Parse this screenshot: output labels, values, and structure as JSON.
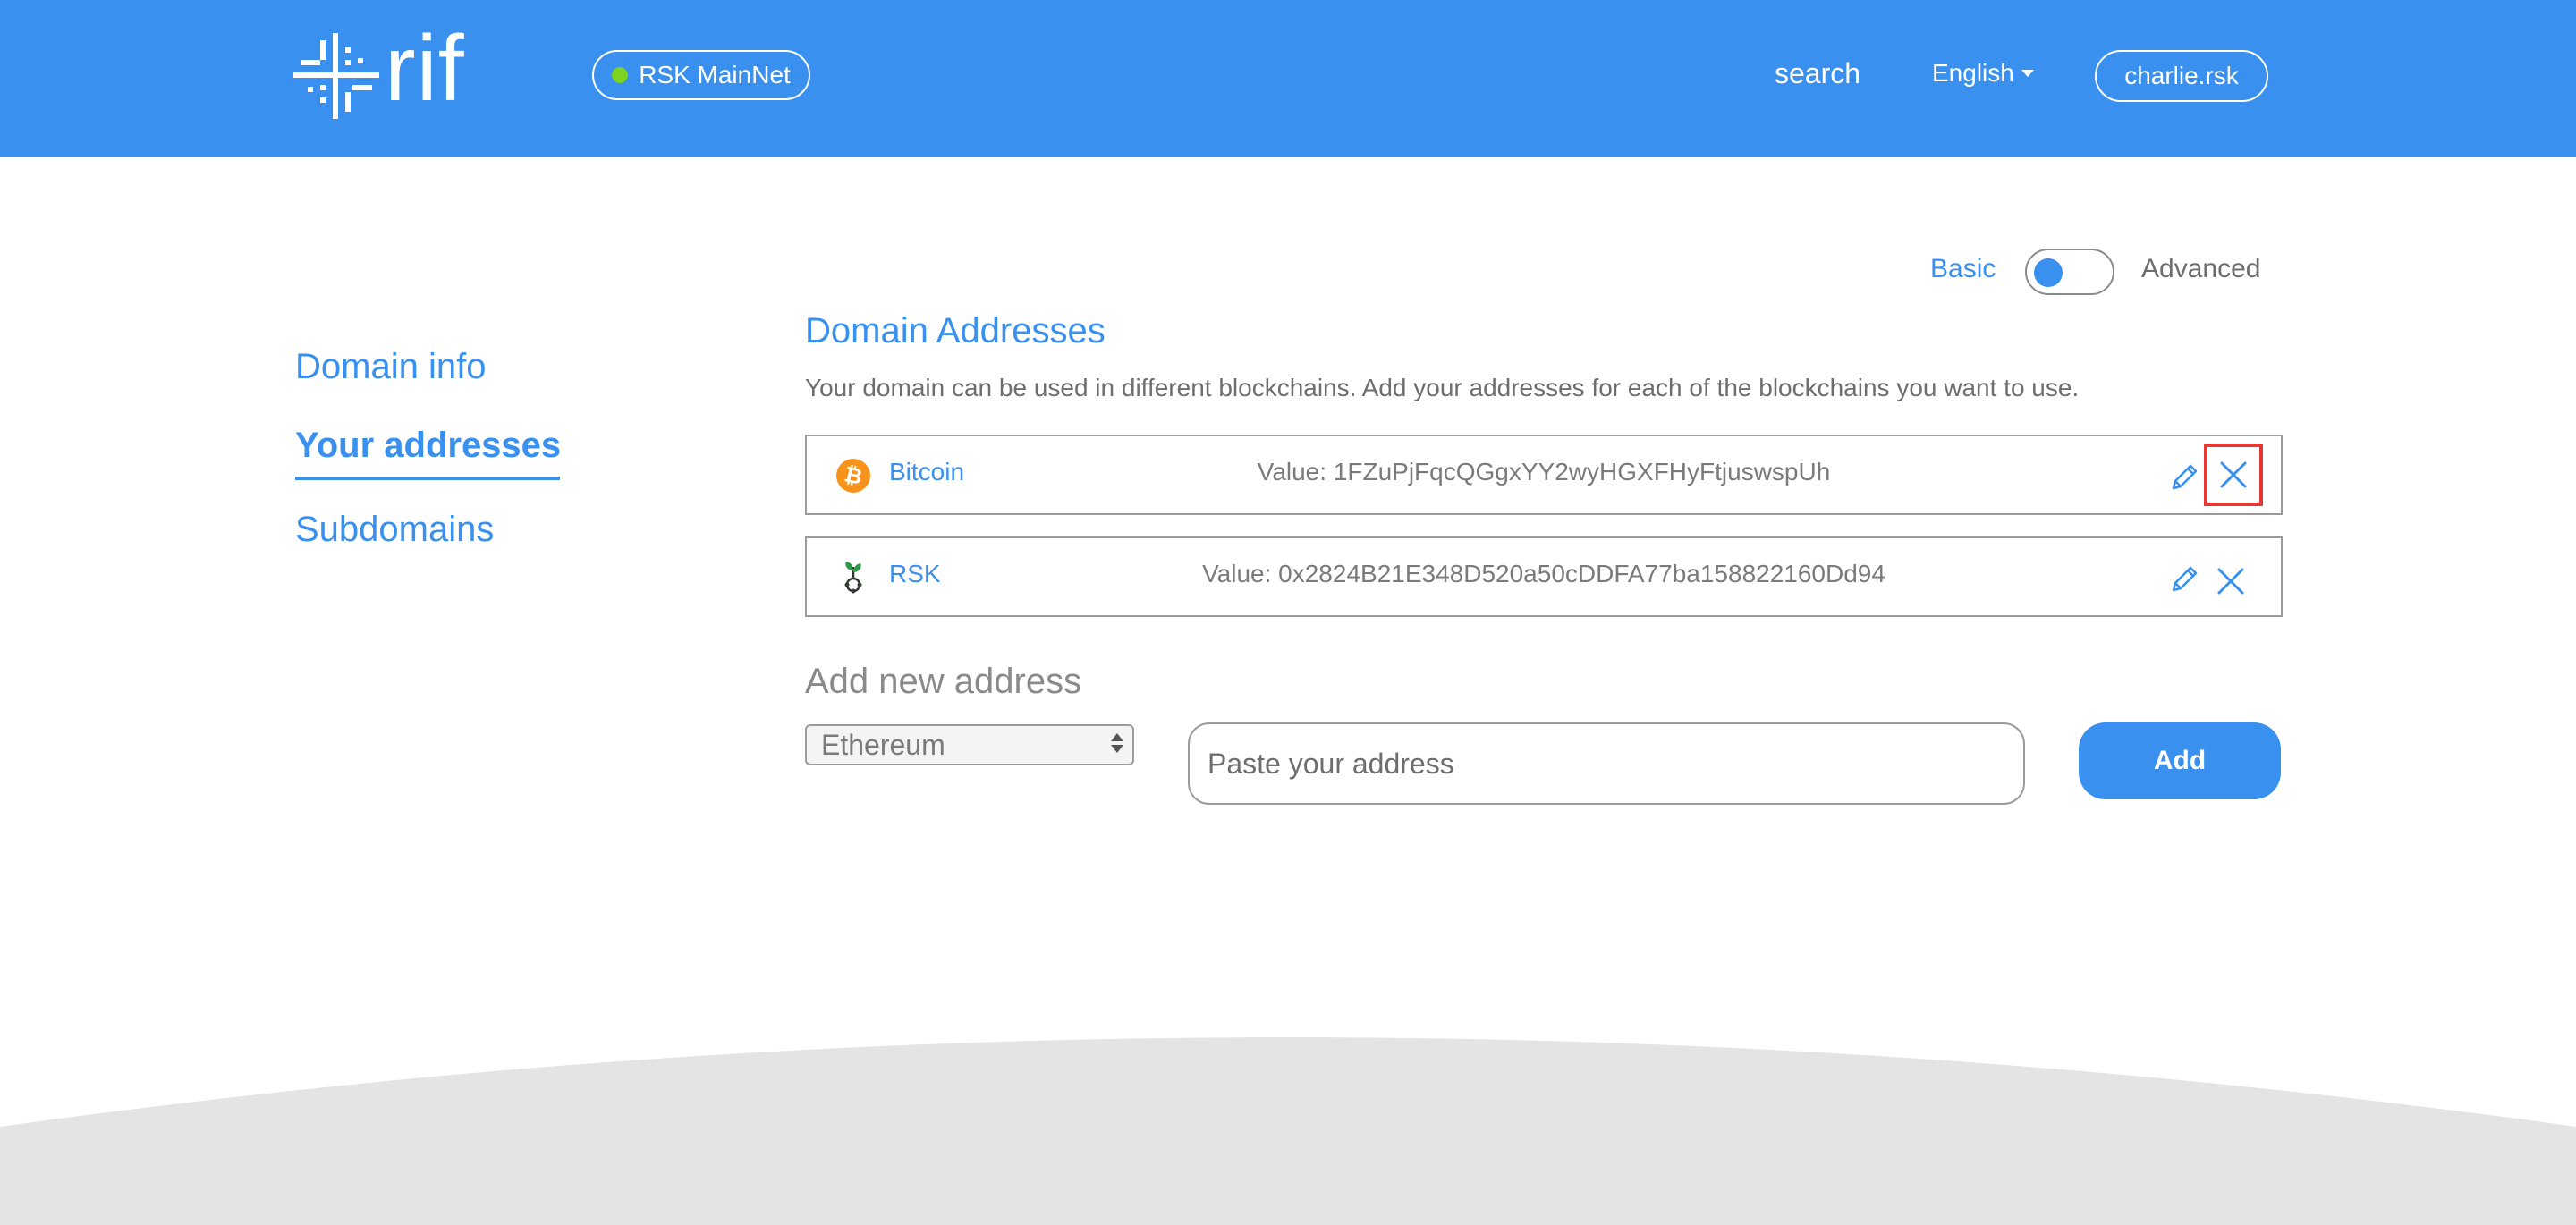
{
  "header": {
    "logo_text": "rif",
    "network_label": "RSK MainNet",
    "search_label": "search",
    "language": "English",
    "account": "charlie.rsk"
  },
  "mode_toggle": {
    "basic_label": "Basic",
    "advanced_label": "Advanced",
    "selected": "Basic"
  },
  "sidebar": {
    "items": [
      {
        "label": "Domain info",
        "active": false
      },
      {
        "label": "Your addresses",
        "active": true
      },
      {
        "label": "Subdomains",
        "active": false
      }
    ]
  },
  "main": {
    "title": "Domain Addresses",
    "description": "Your domain can be used in different blockchains. Add your addresses for each of the blockchains you want to use.",
    "addresses": [
      {
        "chain": "Bitcoin",
        "icon": "bitcoin-icon",
        "value": "Value: 1FZuPjFqcQGgxYY2wyHGXFHyFtjuswspUh"
      },
      {
        "chain": "RSK",
        "icon": "rsk-icon",
        "value": "Value: 0x2824B21E348D520a50cDDFA77ba158822160Dd94"
      }
    ],
    "add_section": {
      "title": "Add new address",
      "selected_chain": "Ethereum",
      "input_placeholder": "Paste your address",
      "add_label": "Add"
    }
  },
  "colors": {
    "brand": "#3990ee",
    "status_online": "#7ed321",
    "highlight": "#e53935",
    "footer_curve": "#e4e4e4"
  }
}
